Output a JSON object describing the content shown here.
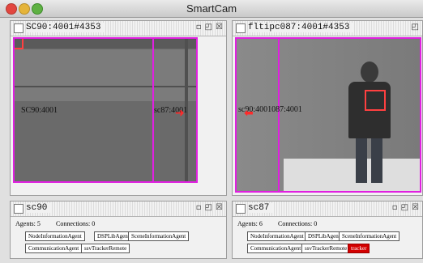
{
  "app": {
    "title": "SmartCam"
  },
  "windows": {
    "cam_left": {
      "title": "SC90:4001#4353",
      "labels": {
        "self": "SC90:4001",
        "neighbor": "sc87:4001"
      }
    },
    "cam_right": {
      "title": "fltipc087:4001#4353",
      "labels": {
        "overlap": "sc90:4001087:4001"
      }
    },
    "agent_left": {
      "title": "sc90",
      "agents_text": "Agents: 5",
      "connections_text": "Connections: 0",
      "agents": [
        "NodeInformationAgent",
        "DSPLibAgent",
        "SceneInformationAgent",
        "CommunicationAgent",
        "ssvTrackerRemote"
      ]
    },
    "agent_right": {
      "title": "sc87",
      "agents_text": "Agents: 6",
      "connections_text": "Connections: 0",
      "agents": [
        "NodeInformationAgent",
        "DSPLibAgent",
        "SceneInformationAgent",
        "CommunicationAgent",
        "ssvTrackerRemote",
        "tracker"
      ]
    }
  },
  "controls": {
    "restore": "▫",
    "maximize": "◰",
    "close": "☒"
  },
  "colors": {
    "overlay_pink": "#e020e0",
    "tracking_red": "#ff4040",
    "active_agent": "#d30000"
  }
}
